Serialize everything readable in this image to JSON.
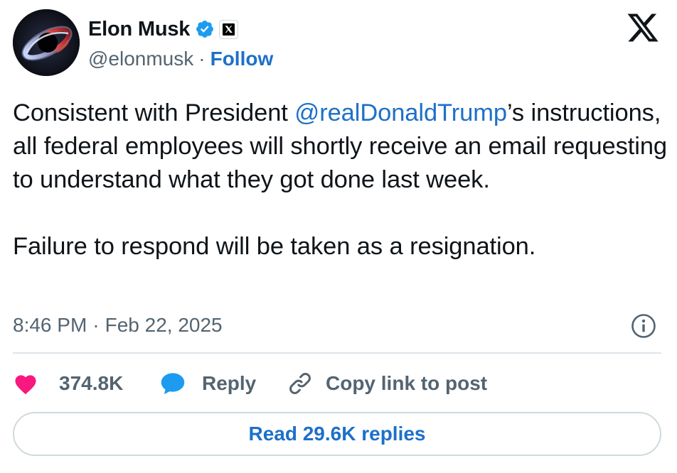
{
  "author": {
    "display_name": "Elon Musk",
    "handle": "@elonmusk",
    "separator": "·",
    "follow_label": "Follow",
    "verified_icon": "verified-badge-icon",
    "affiliate_icon": "x-affiliate-icon"
  },
  "tweet": {
    "text_before_mention": "Consistent with President ",
    "mention": "@realDonaldTrump",
    "text_after_mention": "’s instructions, all federal employees will shortly receive an email requesting to understand what they got done last week.",
    "paragraph_2": "Failure to respond will be taken as a resignation.",
    "time": "8:46 PM",
    "separator": "·",
    "date": "Feb 22, 2025"
  },
  "actions": {
    "likes": "374.8K",
    "reply_label": "Reply",
    "copy_link_label": "Copy link to post",
    "read_replies_label": "Read 29.6K replies"
  },
  "colors": {
    "link_blue": "#1d70c8",
    "like_pink": "#f91880",
    "reply_blue": "#1d9bf0",
    "text_dark": "#0f1419",
    "text_gray": "#536471"
  },
  "icons": [
    "avatar",
    "verified-badge-icon",
    "x-affiliate-icon",
    "x-logo-icon",
    "info-icon",
    "heart-icon",
    "reply-bubble-icon",
    "link-icon"
  ]
}
